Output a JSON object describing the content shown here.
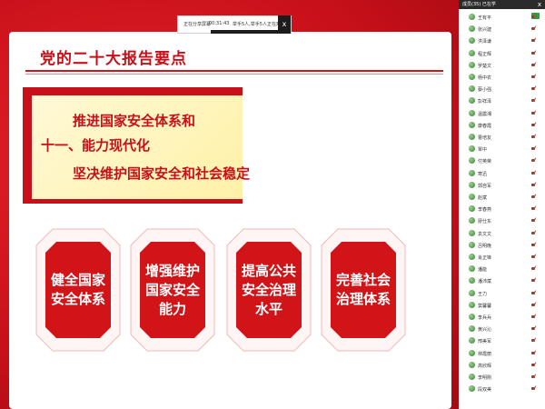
{
  "slide": {
    "title": "党的二十大报告要点",
    "banner": {
      "line1": "推进国家安全体系和",
      "line2": "十一、能力现代化",
      "line3": "坚决维护国家安全和社会稳定"
    },
    "cards": [
      {
        "lines": [
          "健全国家",
          "安全体系"
        ]
      },
      {
        "lines": [
          "增强维护",
          "国家安全",
          "能力"
        ]
      },
      {
        "lines": [
          "提高公共",
          "安全治理",
          "水平"
        ]
      },
      {
        "lines": [
          "完善社会",
          "治理体系"
        ]
      }
    ]
  },
  "toolbar": {
    "label1": "正在分享屏幕",
    "time": "00:31:43",
    "label2": "举手5人,举手5人正在观看",
    "close": "x"
  },
  "panel": {
    "title": "成员(35)   已在学",
    "close": "x",
    "members": [
      "王有平",
      "张兴建",
      "洪泽谦",
      "程正辉",
      "罗楚文",
      "杨中农",
      "蔡小强",
      "彭祥泽",
      "温震湘",
      "康春霞",
      "曹培友",
      "覃中",
      "付英荣",
      "寒迅",
      "郭自军",
      "赵斌",
      "李春燕",
      "廖仕东",
      "袁文文",
      "吕明晚",
      "肖正锋",
      "潘能",
      "潘沛斌",
      "王力",
      "莫馨馨",
      "李兵兵",
      "黄兴沁",
      "邢美军",
      "林霞丽",
      "高欣辉",
      "李明刚",
      "段双美"
    ],
    "badge_color": "#2e9f3a"
  }
}
